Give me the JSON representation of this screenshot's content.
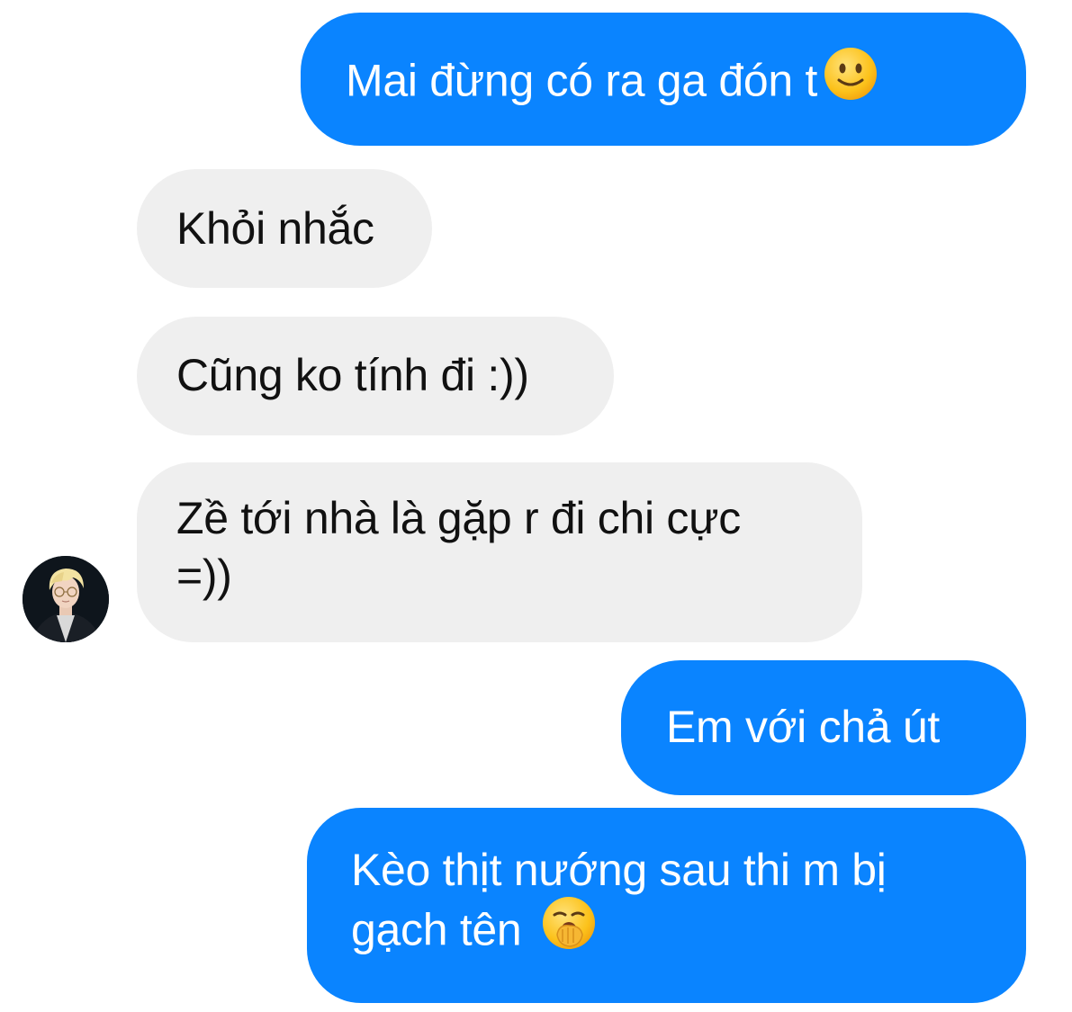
{
  "conversation": {
    "messages": [
      {
        "direction": "sent",
        "text": "Mai đừng có ra ga đón t",
        "emoji": "slightly-smiling-face-icon"
      },
      {
        "direction": "received",
        "text": "Khỏi nhắc"
      },
      {
        "direction": "received",
        "text": "Cũng ko tính đi :))"
      },
      {
        "direction": "received",
        "line1": "Zề tới nhà là gặp r đi chi cực",
        "line2": "=))"
      },
      {
        "direction": "sent",
        "text": "Em với chả út"
      },
      {
        "direction": "sent",
        "line1": "Kèo thịt nướng sau thi m bị",
        "line2": "gạch tên",
        "emoji": "yawning-face-icon"
      }
    ]
  },
  "contact": {
    "avatar": "contact-avatar"
  },
  "colors": {
    "sent_bubble": "#0a84ff",
    "received_bubble": "#efefef",
    "sent_text": "#ffffff",
    "received_text": "#111111"
  }
}
